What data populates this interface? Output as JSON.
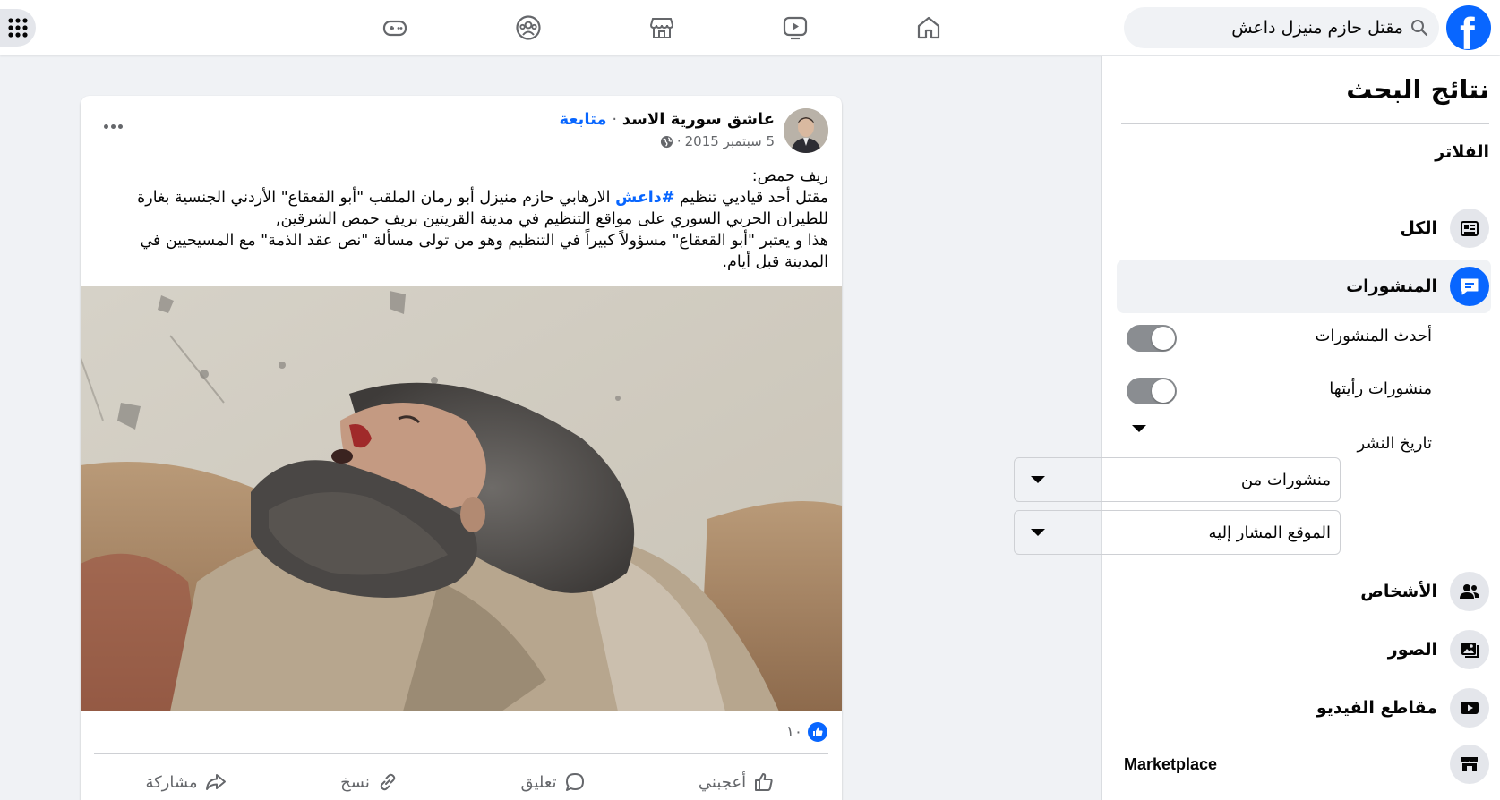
{
  "header": {
    "logo_letter": "f",
    "search_query": "مقتل حازم منيزل داعش",
    "nav_icons": [
      "home-icon",
      "watch-icon",
      "marketplace-icon",
      "groups-icon",
      "gaming-icon"
    ],
    "brand_color": "#0866ff"
  },
  "sidebar": {
    "title": "نتائج البحث",
    "filters_heading": "الفلاتر",
    "items": [
      {
        "label": "الكل",
        "icon": "all-results-icon"
      },
      {
        "label": "المنشورات",
        "icon": "posts-icon",
        "active": true
      },
      {
        "label": "الأشخاص",
        "icon": "people-icon"
      },
      {
        "label": "الصور",
        "icon": "photos-icon"
      },
      {
        "label": "مقاطع الفيديو",
        "icon": "videos-icon"
      },
      {
        "label": "Marketplace",
        "icon": "marketplace-icon"
      }
    ],
    "sub_filters": {
      "recent_posts": "أحدث المنشورات",
      "seen_posts": "منشورات رأيتها",
      "date_posted": "تاريخ النشر",
      "posts_from": "منشورات من",
      "tagged_location": "الموقع المشار إليه"
    }
  },
  "post": {
    "author": "عاشق سورية الاسد",
    "separator": "·",
    "follow_label": "متابعة",
    "date": "5 سبتمبر 2015",
    "meta_separator": "·",
    "text": {
      "line1": "ريف حمص:",
      "line2_pre": "مقتل أحد قياديي تنظيم ",
      "hashtag": "#داعش",
      "line2_post": " الارهابي حازم منيزل أبو رمان الملقب \"أبو القعقاع\" الأردني الجنسية بغارة للطيران الحربي السوري على مواقع التنظيم في مدينة القريتين بريف حمص الشرقين,",
      "line3": "هذا و يعتبر \"أبو القعقاع\" مسؤولاً كبيراً في التنظيم وهو من تولى مسألة \"نص عقد الذمة\" مع المسيحيين في المدينة قبل أيام."
    },
    "reaction_count": "١٠",
    "actions": {
      "like": "أعجبني",
      "comment": "تعليق",
      "copy": "نسخ",
      "share": "مشاركة"
    }
  }
}
